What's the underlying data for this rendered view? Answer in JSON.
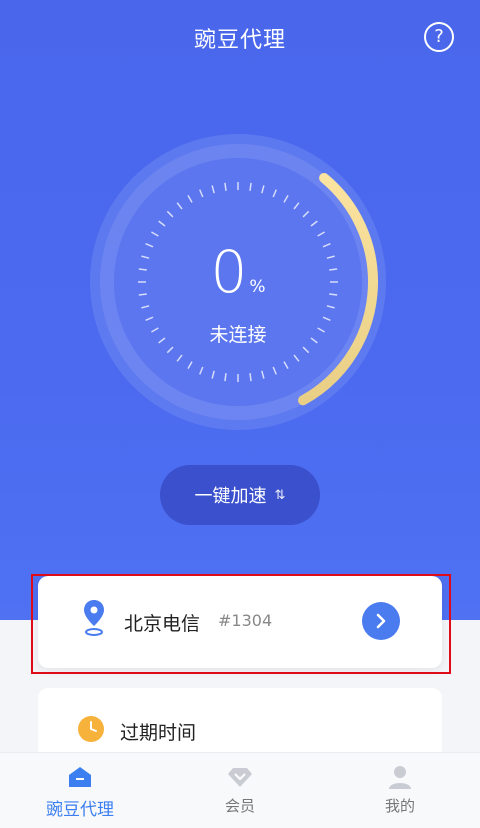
{
  "header": {
    "title": "豌豆代理",
    "help_icon": "?"
  },
  "gauge": {
    "value": "0",
    "unit": "%",
    "status": "未连接",
    "progress": 0.31
  },
  "boost_button": {
    "label": "一键加速",
    "icon": "⇅"
  },
  "server": {
    "name": "北京电信",
    "number": "#1304"
  },
  "expire": {
    "label": "过期时间"
  },
  "tabs": [
    {
      "label": "豌豆代理",
      "icon": "home-icon",
      "active": true
    },
    {
      "label": "会员",
      "icon": "diamond-icon",
      "active": false
    },
    {
      "label": "我的",
      "icon": "user-icon",
      "active": false
    }
  ],
  "colors": {
    "primary": "#4a67ec",
    "accent": "#3b7ff0",
    "progress": "#f6d98a",
    "highlight": "#e00b18"
  }
}
